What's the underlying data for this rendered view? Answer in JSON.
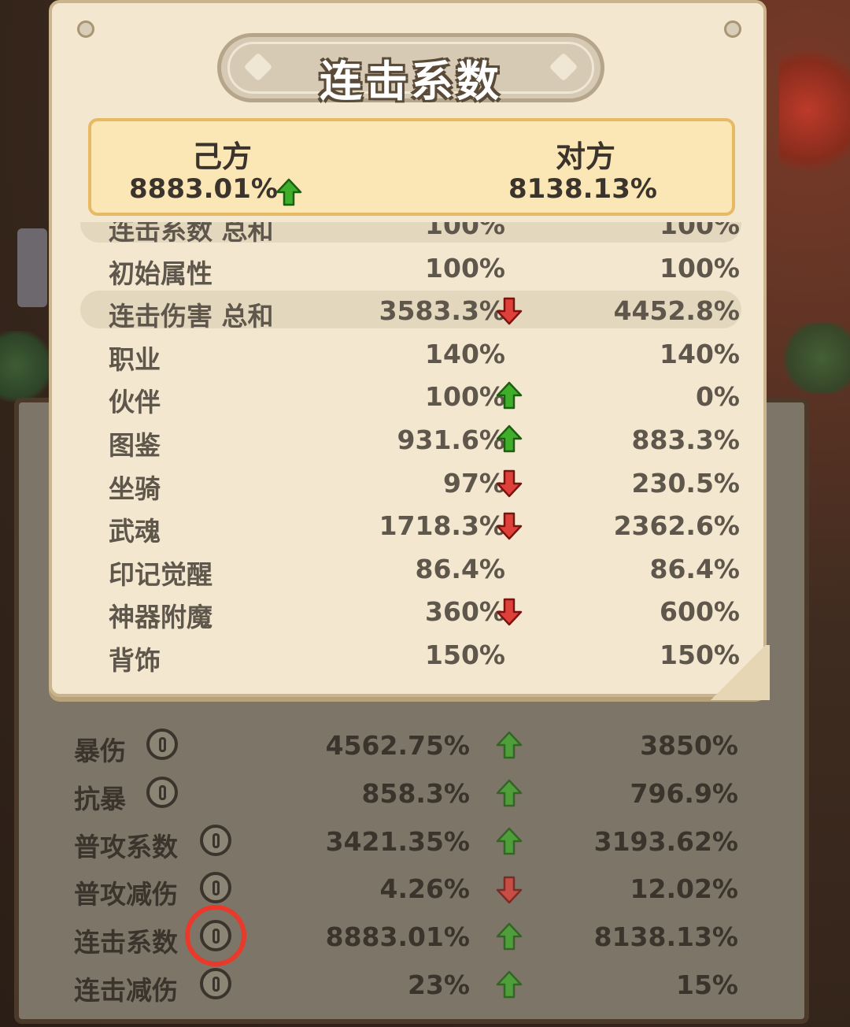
{
  "popup": {
    "title": "连击系数",
    "summary": {
      "own_label": "己方",
      "own_value": "8883.01%",
      "own_trend": "up",
      "opponent_label": "对方",
      "opponent_value": "8138.13%"
    },
    "rows": [
      {
        "label": "连击系数  总和",
        "own": "100%",
        "trend": "none",
        "opponent": "100%",
        "is_total": true,
        "partially_hidden": true
      },
      {
        "label": "初始属性",
        "own": "100%",
        "trend": "none",
        "opponent": "100%",
        "is_total": false
      },
      {
        "label": "连击伤害  总和",
        "own": "3583.3%",
        "trend": "down",
        "opponent": "4452.8%",
        "is_total": true
      },
      {
        "label": "职业",
        "own": "140%",
        "trend": "none",
        "opponent": "140%",
        "is_total": false
      },
      {
        "label": "伙伴",
        "own": "100%",
        "trend": "up",
        "opponent": "0%",
        "is_total": false
      },
      {
        "label": "图鉴",
        "own": "931.6%",
        "trend": "up",
        "opponent": "883.3%",
        "is_total": false
      },
      {
        "label": "坐骑",
        "own": "97%",
        "trend": "down",
        "opponent": "230.5%",
        "is_total": false
      },
      {
        "label": "武魂",
        "own": "1718.3%",
        "trend": "down",
        "opponent": "2362.6%",
        "is_total": false
      },
      {
        "label": "印记觉醒",
        "own": "86.4%",
        "trend": "none",
        "opponent": "86.4%",
        "is_total": false
      },
      {
        "label": "神器附魔",
        "own": "360%",
        "trend": "down",
        "opponent": "600%",
        "is_total": false
      },
      {
        "label": "背饰",
        "own": "150%",
        "trend": "none",
        "opponent": "150%",
        "is_total": false
      }
    ]
  },
  "stats_panel": {
    "rows": [
      {
        "label": "暴伤",
        "own": "4562.75%",
        "trend": "up",
        "opponent": "3850%"
      },
      {
        "label": "抗暴",
        "own": "858.3%",
        "trend": "up",
        "opponent": "796.9%"
      },
      {
        "label": "普攻系数",
        "own": "3421.35%",
        "trend": "up",
        "opponent": "3193.62%"
      },
      {
        "label": "普攻减伤",
        "own": "4.26%",
        "trend": "down",
        "opponent": "12.02%"
      },
      {
        "label": "连击系数",
        "own": "8883.01%",
        "trend": "up",
        "opponent": "8138.13%",
        "highlighted": true
      },
      {
        "label": "连击减伤",
        "own": "23%",
        "trend": "up",
        "opponent": "15%"
      }
    ]
  },
  "colors": {
    "up": "#3fae2a",
    "down": "#e0403a",
    "highlight_circle": "#e8392b"
  },
  "icons": {
    "up": "green-up-arrow-icon",
    "down": "red-down-arrow-icon",
    "info": "info-icon"
  }
}
